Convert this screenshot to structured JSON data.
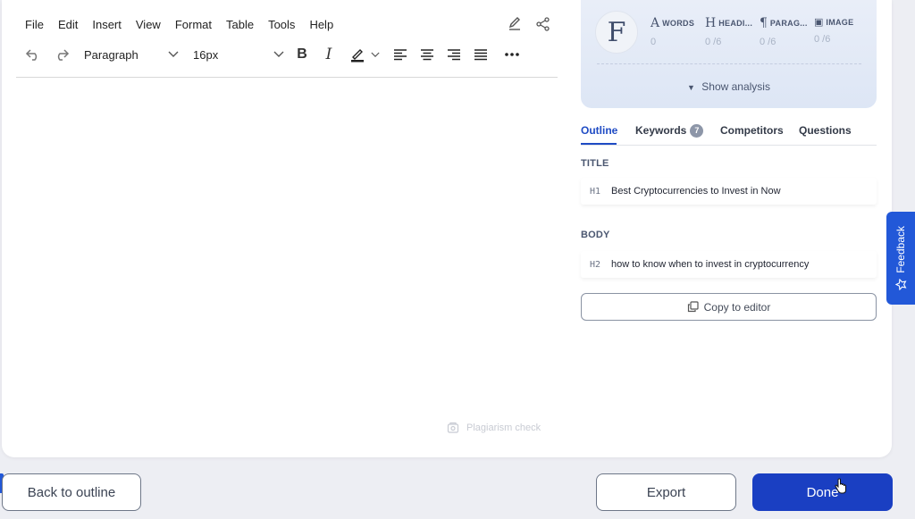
{
  "menu": [
    "File",
    "Edit",
    "Insert",
    "View",
    "Format",
    "Table",
    "Tools",
    "Help"
  ],
  "toolbar": {
    "block_format": "Paragraph",
    "font_size": "16px"
  },
  "plagiarism_label": "Plagiarism check",
  "analysis": {
    "logo_letter": "F",
    "metrics": [
      {
        "glyph": "A",
        "label": "WORDS",
        "value": "0"
      },
      {
        "glyph": "H",
        "label": "HEADI...",
        "value": "0 /6"
      },
      {
        "glyph": "¶",
        "label": "PARAG...",
        "value": "0 /6"
      },
      {
        "glyph": "▣",
        "label": "IMAGE",
        "value": "0 /6"
      }
    ],
    "show_label": "Show analysis"
  },
  "tabs": {
    "outline": "Outline",
    "keywords": "Keywords",
    "keywords_count": "7",
    "competitors": "Competitors",
    "questions": "Questions"
  },
  "outline": {
    "title_label": "TITLE",
    "title_item": {
      "tag": "H1",
      "text": "Best Cryptocurrencies to Invest in Now"
    },
    "body_label": "BODY",
    "body_item": {
      "tag": "H2",
      "text": "how to know when to invest in cryptocurrency"
    }
  },
  "copy_label": "Copy to editor",
  "feedback_label": "Feedback",
  "buttons": {
    "back": "Back to outline",
    "export": "Export",
    "done": "Done"
  },
  "colors": {
    "primary": "#1a3fc2",
    "accent_tab": "#1f4bc4",
    "feedback": "#2258d8"
  }
}
